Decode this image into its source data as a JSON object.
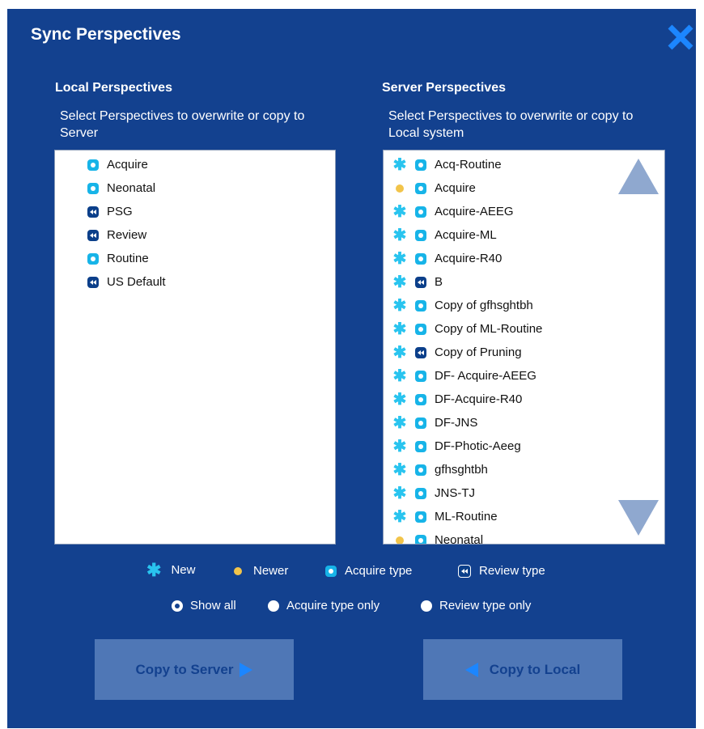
{
  "dialog": {
    "title": "Sync Perspectives"
  },
  "local": {
    "heading": "Local Perspectives",
    "instruction": "Select Perspectives to overwrite or copy to Server",
    "items": [
      {
        "label": "Acquire",
        "type": "acquire"
      },
      {
        "label": "Neonatal",
        "type": "acquire"
      },
      {
        "label": "PSG",
        "type": "review"
      },
      {
        "label": "Review",
        "type": "review"
      },
      {
        "label": "Routine",
        "type": "acquire"
      },
      {
        "label": "US Default",
        "type": "review"
      }
    ]
  },
  "server": {
    "heading": "Server Perspectives",
    "instruction": "Select Perspectives to overwrite or copy to Local system",
    "items": [
      {
        "label": "Acq-Routine",
        "status": "new",
        "type": "acquire"
      },
      {
        "label": "Acquire",
        "status": "newer",
        "type": "acquire"
      },
      {
        "label": "Acquire-AEEG",
        "status": "new",
        "type": "acquire"
      },
      {
        "label": "Acquire-ML",
        "status": "new",
        "type": "acquire"
      },
      {
        "label": "Acquire-R40",
        "status": "new",
        "type": "acquire"
      },
      {
        "label": "B",
        "status": "new",
        "type": "review"
      },
      {
        "label": "Copy of gfhsghtbh",
        "status": "new",
        "type": "acquire"
      },
      {
        "label": "Copy of ML-Routine",
        "status": "new",
        "type": "acquire"
      },
      {
        "label": "Copy of Pruning",
        "status": "new",
        "type": "review"
      },
      {
        "label": "DF- Acquire-AEEG",
        "status": "new",
        "type": "acquire"
      },
      {
        "label": "DF-Acquire-R40",
        "status": "new",
        "type": "acquire"
      },
      {
        "label": "DF-JNS",
        "status": "new",
        "type": "acquire"
      },
      {
        "label": "DF-Photic-Aeeg",
        "status": "new",
        "type": "acquire"
      },
      {
        "label": "gfhsghtbh",
        "status": "new",
        "type": "acquire"
      },
      {
        "label": "JNS-TJ",
        "status": "new",
        "type": "acquire"
      },
      {
        "label": "ML-Routine",
        "status": "new",
        "type": "acquire"
      },
      {
        "label": "Neonatal",
        "status": "newer",
        "type": "acquire"
      }
    ]
  },
  "legend": {
    "new": "New",
    "newer": "Newer",
    "acquire": "Acquire type",
    "review": "Review type"
  },
  "filters": {
    "selected": "show_all",
    "show_all": "Show all",
    "acquire_only": "Acquire type only",
    "review_only": "Review type only"
  },
  "buttons": {
    "copy_to_server": "Copy to Server",
    "copy_to_local": "Copy to Local"
  },
  "colors": {
    "background": "#13418f",
    "new_mark": "#29c4ef",
    "newer_mark": "#f2c44a",
    "button": "#4f77b6"
  },
  "icons": {
    "close": "close-x-icon",
    "acquire": "acquire-type-icon",
    "review": "review-type-icon"
  }
}
